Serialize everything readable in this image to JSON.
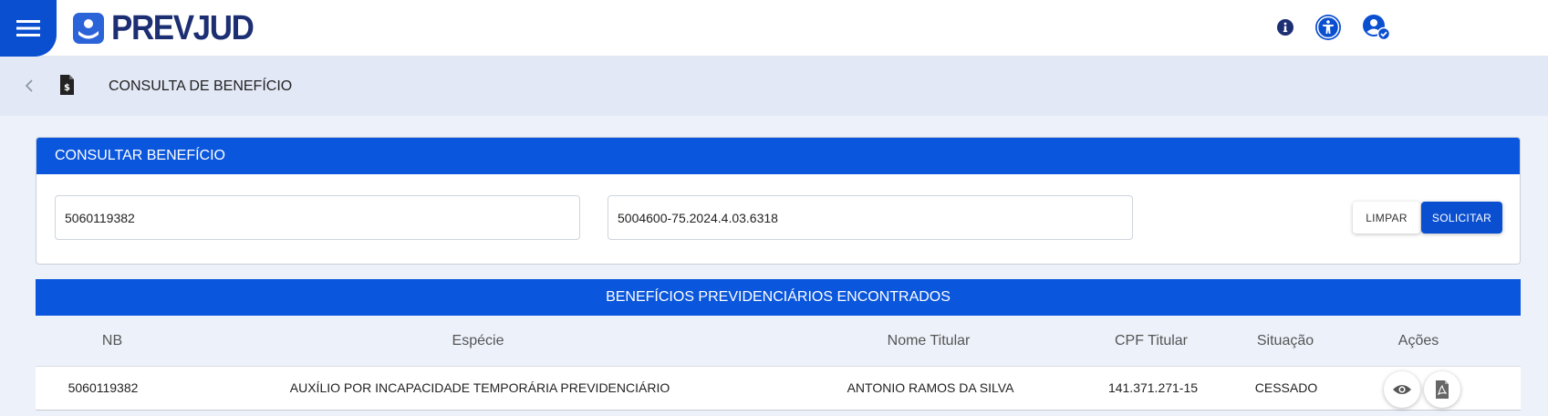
{
  "app": {
    "logo_text": "PREVJUD"
  },
  "breadcrumb": {
    "title": "CONSULTA DE BENEFÍCIO"
  },
  "search_card": {
    "title": "CONSULTAR BENEFÍCIO",
    "nb_value": "5060119382",
    "process_value": "5004600-75.2024.4.03.6318",
    "clear_label": "LIMPAR",
    "submit_label": "SOLICITAR"
  },
  "results": {
    "title": "BENEFÍCIOS PREVIDENCIÁRIOS ENCONTRADOS",
    "columns": [
      "NB",
      "Espécie",
      "Nome Titular",
      "CPF Titular",
      "Situação",
      "Ações"
    ],
    "rows": [
      {
        "nb": "5060119382",
        "especie": "AUXÍLIO POR INCAPACIDADE TEMPORÁRIA PREVIDENCIÁRIO",
        "nome": "ANTONIO RAMOS DA SILVA",
        "cpf": "141.371.271-15",
        "situacao": "CESSADO",
        "actions": [
          "eye-icon",
          "pdf-icon"
        ]
      }
    ]
  },
  "icons": {
    "menu": "menu-icon",
    "info": "info-icon",
    "accessibility": "accessibility-icon",
    "user": "user-check-icon",
    "back": "chevron-left-icon",
    "document": "document-dollar-icon"
  },
  "colors": {
    "primary": "#0a56dc",
    "primary_dark": "#0a4fd0",
    "logo": "#1d2f73",
    "page_bg": "#edf1fa",
    "crumb_bg": "#e2e8f6"
  }
}
